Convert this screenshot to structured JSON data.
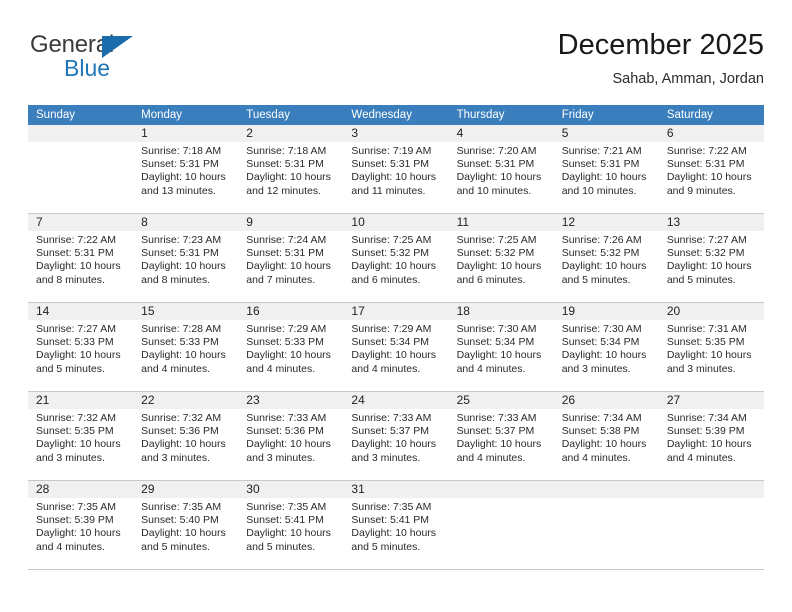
{
  "brand": {
    "line1": "General",
    "line2": "Blue",
    "flag_icon": "triangle-flag-icon",
    "color_text": "#3c3c3c",
    "color_blue": "#2077b8"
  },
  "header": {
    "title": "December 2025",
    "subtitle": "Sahab, Amman, Jordan"
  },
  "calendar": {
    "header_color": "#3a7ebe",
    "daynum_band_color": "#f0f0f0",
    "weekdays": [
      "Sunday",
      "Monday",
      "Tuesday",
      "Wednesday",
      "Thursday",
      "Friday",
      "Saturday"
    ],
    "weeks": [
      [
        {
          "day": "",
          "lines": []
        },
        {
          "day": "1",
          "lines": [
            "Sunrise: 7:18 AM",
            "Sunset: 5:31 PM",
            "Daylight: 10 hours",
            "and 13 minutes."
          ]
        },
        {
          "day": "2",
          "lines": [
            "Sunrise: 7:18 AM",
            "Sunset: 5:31 PM",
            "Daylight: 10 hours",
            "and 12 minutes."
          ]
        },
        {
          "day": "3",
          "lines": [
            "Sunrise: 7:19 AM",
            "Sunset: 5:31 PM",
            "Daylight: 10 hours",
            "and 11 minutes."
          ]
        },
        {
          "day": "4",
          "lines": [
            "Sunrise: 7:20 AM",
            "Sunset: 5:31 PM",
            "Daylight: 10 hours",
            "and 10 minutes."
          ]
        },
        {
          "day": "5",
          "lines": [
            "Sunrise: 7:21 AM",
            "Sunset: 5:31 PM",
            "Daylight: 10 hours",
            "and 10 minutes."
          ]
        },
        {
          "day": "6",
          "lines": [
            "Sunrise: 7:22 AM",
            "Sunset: 5:31 PM",
            "Daylight: 10 hours",
            "and 9 minutes."
          ]
        }
      ],
      [
        {
          "day": "7",
          "lines": [
            "Sunrise: 7:22 AM",
            "Sunset: 5:31 PM",
            "Daylight: 10 hours",
            "and 8 minutes."
          ]
        },
        {
          "day": "8",
          "lines": [
            "Sunrise: 7:23 AM",
            "Sunset: 5:31 PM",
            "Daylight: 10 hours",
            "and 8 minutes."
          ]
        },
        {
          "day": "9",
          "lines": [
            "Sunrise: 7:24 AM",
            "Sunset: 5:31 PM",
            "Daylight: 10 hours",
            "and 7 minutes."
          ]
        },
        {
          "day": "10",
          "lines": [
            "Sunrise: 7:25 AM",
            "Sunset: 5:32 PM",
            "Daylight: 10 hours",
            "and 6 minutes."
          ]
        },
        {
          "day": "11",
          "lines": [
            "Sunrise: 7:25 AM",
            "Sunset: 5:32 PM",
            "Daylight: 10 hours",
            "and 6 minutes."
          ]
        },
        {
          "day": "12",
          "lines": [
            "Sunrise: 7:26 AM",
            "Sunset: 5:32 PM",
            "Daylight: 10 hours",
            "and 5 minutes."
          ]
        },
        {
          "day": "13",
          "lines": [
            "Sunrise: 7:27 AM",
            "Sunset: 5:32 PM",
            "Daylight: 10 hours",
            "and 5 minutes."
          ]
        }
      ],
      [
        {
          "day": "14",
          "lines": [
            "Sunrise: 7:27 AM",
            "Sunset: 5:33 PM",
            "Daylight: 10 hours",
            "and 5 minutes."
          ]
        },
        {
          "day": "15",
          "lines": [
            "Sunrise: 7:28 AM",
            "Sunset: 5:33 PM",
            "Daylight: 10 hours",
            "and 4 minutes."
          ]
        },
        {
          "day": "16",
          "lines": [
            "Sunrise: 7:29 AM",
            "Sunset: 5:33 PM",
            "Daylight: 10 hours",
            "and 4 minutes."
          ]
        },
        {
          "day": "17",
          "lines": [
            "Sunrise: 7:29 AM",
            "Sunset: 5:34 PM",
            "Daylight: 10 hours",
            "and 4 minutes."
          ]
        },
        {
          "day": "18",
          "lines": [
            "Sunrise: 7:30 AM",
            "Sunset: 5:34 PM",
            "Daylight: 10 hours",
            "and 4 minutes."
          ]
        },
        {
          "day": "19",
          "lines": [
            "Sunrise: 7:30 AM",
            "Sunset: 5:34 PM",
            "Daylight: 10 hours",
            "and 3 minutes."
          ]
        },
        {
          "day": "20",
          "lines": [
            "Sunrise: 7:31 AM",
            "Sunset: 5:35 PM",
            "Daylight: 10 hours",
            "and 3 minutes."
          ]
        }
      ],
      [
        {
          "day": "21",
          "lines": [
            "Sunrise: 7:32 AM",
            "Sunset: 5:35 PM",
            "Daylight: 10 hours",
            "and 3 minutes."
          ]
        },
        {
          "day": "22",
          "lines": [
            "Sunrise: 7:32 AM",
            "Sunset: 5:36 PM",
            "Daylight: 10 hours",
            "and 3 minutes."
          ]
        },
        {
          "day": "23",
          "lines": [
            "Sunrise: 7:33 AM",
            "Sunset: 5:36 PM",
            "Daylight: 10 hours",
            "and 3 minutes."
          ]
        },
        {
          "day": "24",
          "lines": [
            "Sunrise: 7:33 AM",
            "Sunset: 5:37 PM",
            "Daylight: 10 hours",
            "and 3 minutes."
          ]
        },
        {
          "day": "25",
          "lines": [
            "Sunrise: 7:33 AM",
            "Sunset: 5:37 PM",
            "Daylight: 10 hours",
            "and 4 minutes."
          ]
        },
        {
          "day": "26",
          "lines": [
            "Sunrise: 7:34 AM",
            "Sunset: 5:38 PM",
            "Daylight: 10 hours",
            "and 4 minutes."
          ]
        },
        {
          "day": "27",
          "lines": [
            "Sunrise: 7:34 AM",
            "Sunset: 5:39 PM",
            "Daylight: 10 hours",
            "and 4 minutes."
          ]
        }
      ],
      [
        {
          "day": "28",
          "lines": [
            "Sunrise: 7:35 AM",
            "Sunset: 5:39 PM",
            "Daylight: 10 hours",
            "and 4 minutes."
          ]
        },
        {
          "day": "29",
          "lines": [
            "Sunrise: 7:35 AM",
            "Sunset: 5:40 PM",
            "Daylight: 10 hours",
            "and 5 minutes."
          ]
        },
        {
          "day": "30",
          "lines": [
            "Sunrise: 7:35 AM",
            "Sunset: 5:41 PM",
            "Daylight: 10 hours",
            "and 5 minutes."
          ]
        },
        {
          "day": "31",
          "lines": [
            "Sunrise: 7:35 AM",
            "Sunset: 5:41 PM",
            "Daylight: 10 hours",
            "and 5 minutes."
          ]
        },
        {
          "day": "",
          "lines": []
        },
        {
          "day": "",
          "lines": []
        },
        {
          "day": "",
          "lines": []
        }
      ]
    ]
  }
}
